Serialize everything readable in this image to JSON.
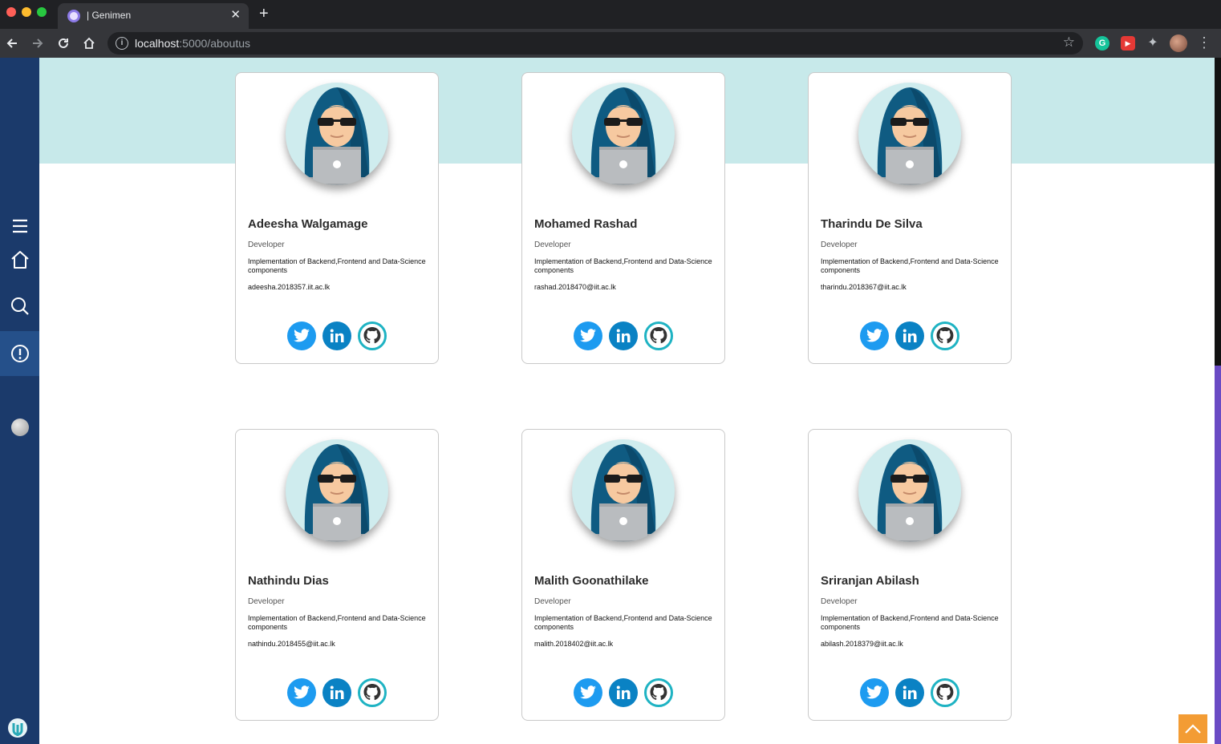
{
  "browser": {
    "tab_title": "| Genimen",
    "url_host": "localhost",
    "url_path": ":5000/aboutus"
  },
  "colors": {
    "sidebar": "#1b3a6b",
    "hero_band": "#c7e9ea",
    "twitter": "#1d9bf0",
    "linkedin": "#0a82c4",
    "github_ring": "#1fb3c3",
    "back_to_top": "#f39c34"
  },
  "sidebar": {
    "items": [
      {
        "icon": "menu-icon"
      },
      {
        "icon": "home-icon"
      },
      {
        "icon": "search-icon"
      },
      {
        "icon": "info-icon",
        "active": true
      },
      {
        "icon": "moon-icon"
      }
    ]
  },
  "team": [
    {
      "name": "Adeesha Walgamage",
      "role": "Developer",
      "description": "Implementation of Backend,Frontend and Data-Science components",
      "email": "adeesha.2018357.iit.ac.lk"
    },
    {
      "name": "Mohamed Rashad",
      "role": "Developer",
      "description": "Implementation of Backend,Frontend and Data-Science components",
      "email": "rashad.2018470@iit.ac.lk"
    },
    {
      "name": "Tharindu De Silva",
      "role": "Developer",
      "description": "Implementation of Backend,Frontend and Data-Science components",
      "email": "tharindu.2018367@iit.ac.lk"
    },
    {
      "name": "Nathindu Dias",
      "role": "Developer",
      "description": "Implementation of Backend,Frontend and Data-Science components",
      "email": "nathindu.2018455@iit.ac.lk"
    },
    {
      "name": "Malith Goonathilake",
      "role": "Developer",
      "description": "Implementation of Backend,Frontend and Data-Science components",
      "email": "malith.2018402@iit.ac.lk"
    },
    {
      "name": "Sriranjan Abilash",
      "role": "Developer",
      "description": "Implementation of Backend,Frontend and Data-Science components",
      "email": "abilash.2018379@iit.ac.lk"
    }
  ]
}
